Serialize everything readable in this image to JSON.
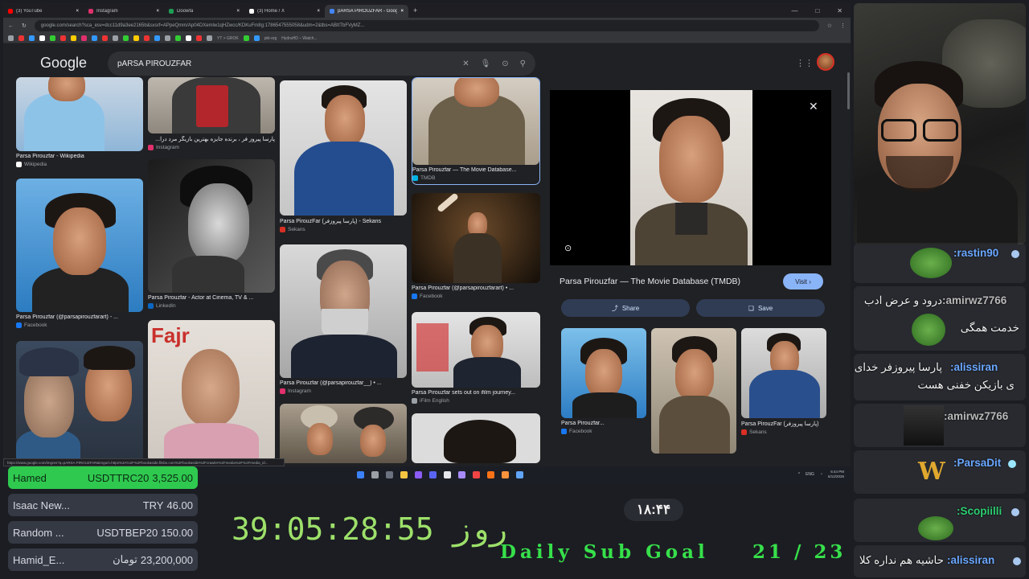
{
  "browser": {
    "tabs": [
      {
        "label": "(3) YouTube",
        "color": "#ff0000"
      },
      {
        "label": "Instagram",
        "color": "#e1306c"
      },
      {
        "label": "Doowfa",
        "color": "#1f9d55"
      },
      {
        "label": "(3) Home / X",
        "color": "#ffffff"
      },
      {
        "label": "pARSA PIROUZFAR - Google Se...",
        "color": "#4285f4",
        "active": true
      }
    ],
    "url": "google.com/search?sca_esv=dcc11d9a3ee2165b&sxsrf=APpeQmm/Ap04DXemlw1qHZwcc/KDKuFm8g:1786547555058&udm=2&tbs=ABItTbFVyMZ...",
    "bookmarks": [
      "YT > GROK",
      "pkt-org",
      "HydraHD – Watch..."
    ]
  },
  "google": {
    "logo": "Google",
    "query": "pARSA PIROUZFAR"
  },
  "results": [
    {
      "caption": "Parsa Pirouzfar - Wikipedia",
      "source": "Wikipedia",
      "src_color": "#ffffff"
    },
    {
      "caption": "پارسا پیروز فر ، برنده جایزه بهترین بازیگر مرد درا...",
      "source": "Instagram",
      "src_color": "#e1306c"
    },
    {
      "caption": "Parsa Pirouzfar (@parsapirouzfarart) - ...",
      "source": "Facebook",
      "src_color": "#1877f2"
    },
    {
      "caption": "Parsa Pirouzfar - Actor at Cinema, TV & ...",
      "source": "LinkedIn",
      "src_color": "#0a66c2"
    },
    {
      "caption": "Parsa PirouzFar (پارسا پیروزفر) - Sekans",
      "source": "Sekans",
      "src_color": "#d93025"
    },
    {
      "caption": "Parsa Pirouzfar (@parsapirouzfar__) • ...",
      "source": "Instagram",
      "src_color": "#e1306c"
    },
    {
      "caption": "Parsa Pirouzfar — The Movie Database...",
      "source": "TMDB",
      "src_color": "#01b4e4"
    },
    {
      "caption": "Parsa Pirouzfar (@parsapirouzfarart) • ...",
      "source": "Facebook",
      "src_color": "#1877f2"
    },
    {
      "caption": "Parsa Pirouzfar sets out on ifilm journey...",
      "source": "iFilm English",
      "src_color": "#9aa0a6"
    }
  ],
  "preview": {
    "title": "Parsa Pirouzfar — The Movie Database (TMDB)",
    "visit_label": "Visit ›",
    "share_label": "Share",
    "save_label": "Save",
    "related": [
      {
        "caption": "Parsa Pirouzfar...",
        "source": "Facebook",
        "src_color": "#1877f2"
      },
      {
        "caption": "",
        "source": "",
        "src_color": ""
      },
      {
        "caption": "Parsa PirouzFar (پارسا پیروزفر)",
        "source": "Sekans",
        "src_color": "#d93025"
      }
    ]
  },
  "status_url": "https://www.google.com/imgres?q=pARSA PIROUZFAR&imgurl=https%3A%2F%2Fbookaside.filsbs.com%2Fbookaside%2Fcrawler%2Fmedia%2F%2Fmedia_id...",
  "taskbar": {
    "lang": "ENG",
    "time": "6:44 PM",
    "date": "6/12/2026"
  },
  "chat": [
    {
      "user": ":rastin90",
      "color": "#6aa7ff",
      "text": ""
    },
    {
      "user": ":amirwz7766",
      "color": "#b9b9b9",
      "text": "درود و عرض ادب",
      "text2": "خدمت همگی"
    },
    {
      "user": ":alissiran",
      "color": "#6aa7ff",
      "text": "پارسا پیروزفر خدای",
      "text2": "ی بازیکن خفنی هست"
    },
    {
      "user": ":amirwz7766",
      "color": "#b9b9b9",
      "text": ""
    },
    {
      "user": ":ParsaDit",
      "color": "#6aa7ff",
      "text": ""
    },
    {
      "user": ":Scopiilli",
      "color": "#2ecc71",
      "text": ""
    },
    {
      "user": ":alissiran",
      "color": "#6aa7ff",
      "text": "حاشیه هم نداره کلا"
    }
  ],
  "donations": [
    {
      "name": "Hamed",
      "currency": "USDTTRC20",
      "amount": "3,525.00"
    },
    {
      "name": "Isaac New...",
      "currency": "TRY",
      "amount": "46.00"
    },
    {
      "name": "Random ...",
      "currency": "USDTBEP20",
      "amount": "150.00"
    },
    {
      "name": "Hamid_E...",
      "currency": "تومان",
      "amount": "23,200,000"
    }
  ],
  "overlay": {
    "timer": "روز 39:05:28:55",
    "time_pill": "۱۸:۴۴",
    "goal_label": "Daily Sub Goal",
    "goal_count": "21 / 23"
  }
}
